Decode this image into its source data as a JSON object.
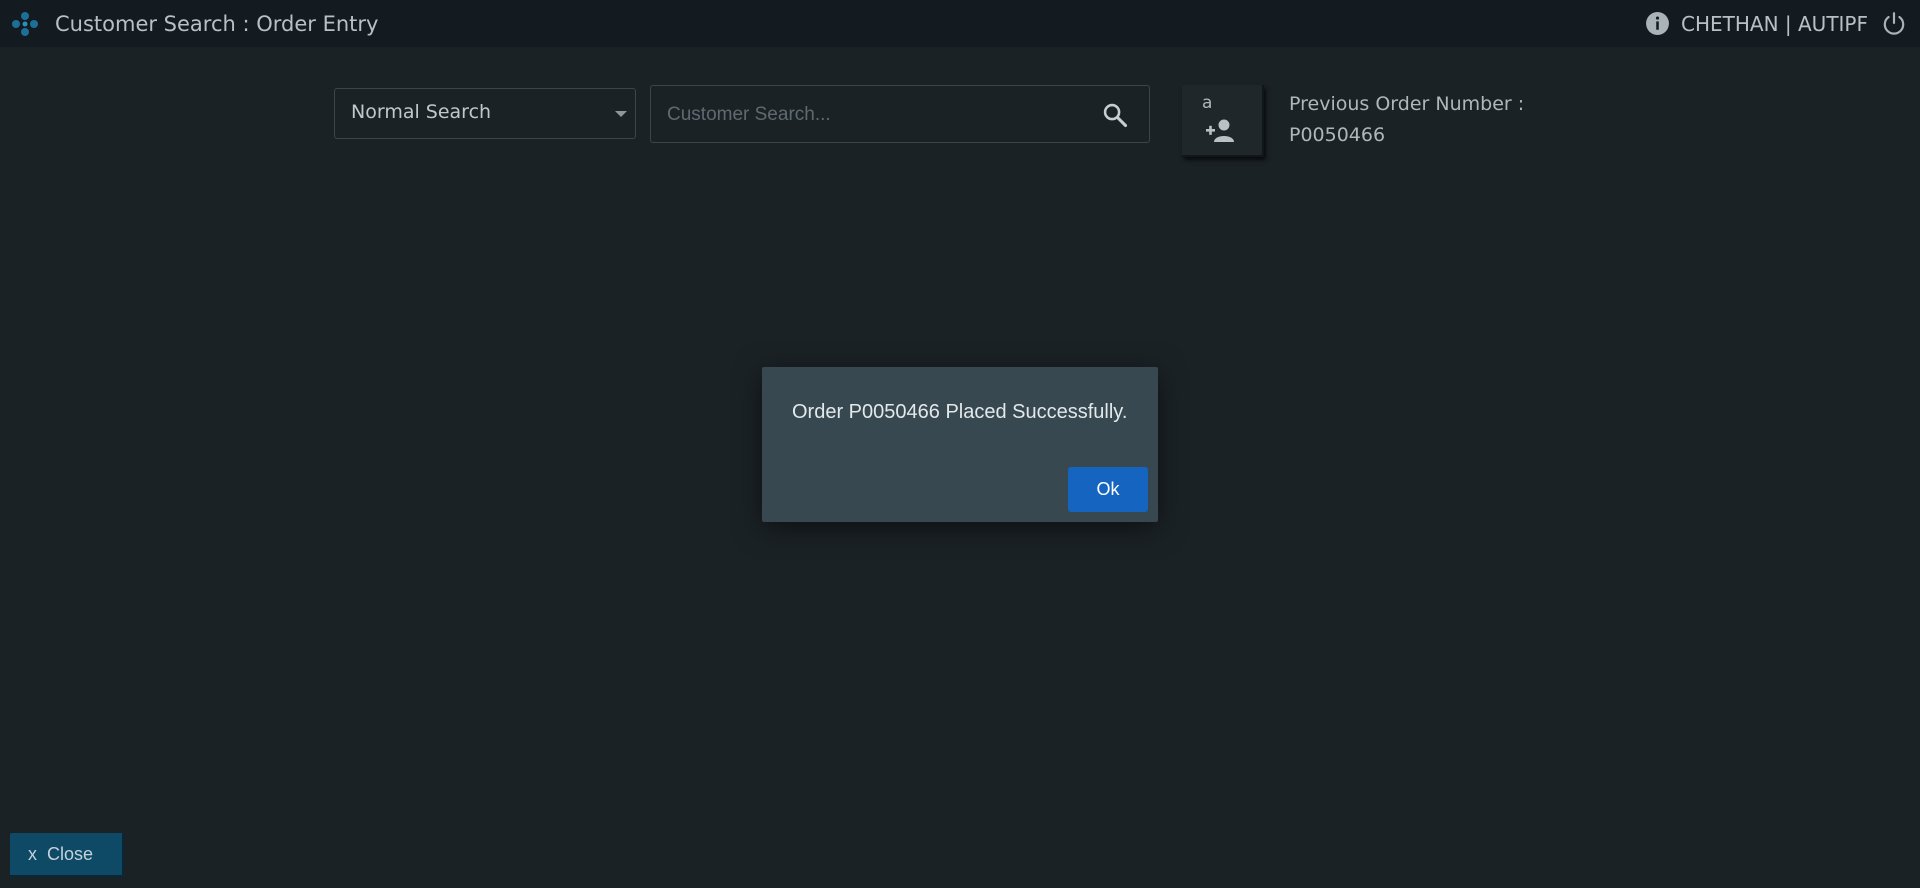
{
  "header": {
    "title": "Customer Search : Order Entry",
    "user": "CHETHAN | AUTIPF",
    "icons": {
      "logo": "app-logo-icon",
      "info": "info-icon",
      "logout": "power-icon"
    }
  },
  "search": {
    "mode": "Normal Search",
    "placeholder": "Customer Search...",
    "value": ""
  },
  "add_customer": {
    "letter": "a",
    "icon": "person-add-icon"
  },
  "previous_order": {
    "label": "Previous Order Number :",
    "number": "P0050466"
  },
  "dialog": {
    "message": "Order P0050466 Placed Successfully.",
    "ok_label": "Ok"
  },
  "footer": {
    "close_prefix": "x",
    "close_label": "Close"
  },
  "colors": {
    "background": "#1b2226",
    "topbar": "#141b20",
    "dialog": "#374850",
    "primary_button": "#1565c0",
    "close_button": "#0e4a66"
  }
}
